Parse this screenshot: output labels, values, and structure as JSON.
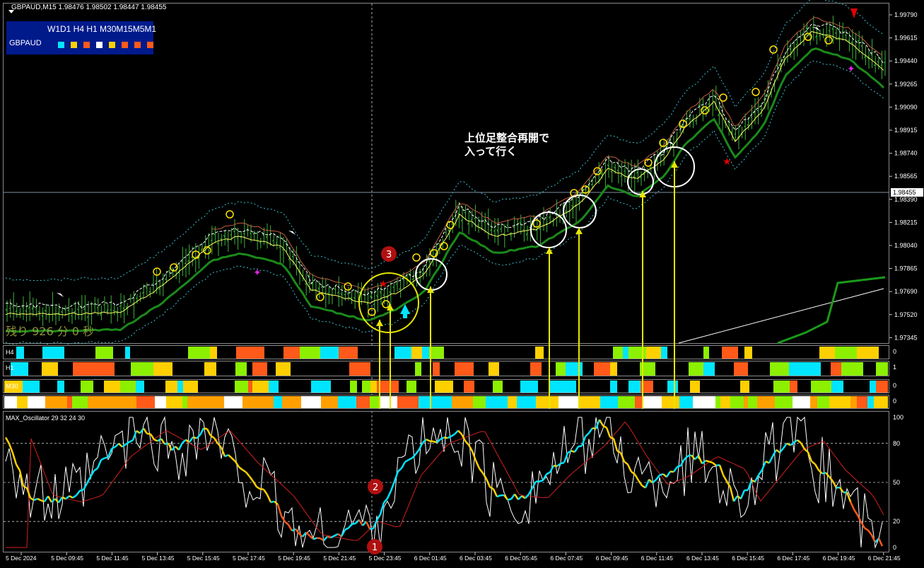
{
  "header": {
    "symbol_tf": "GBPAUD,M15",
    "ohlc": "1.98476 1.98502 1.98447 1.98455"
  },
  "tf_panel": {
    "labels": "W1D1 H4 H1 M30M15M5M1",
    "symbol": "GBPAUD",
    "squares": [
      "#00e5ff",
      "#ffd000",
      "#ff5a1a",
      "#ffffff",
      "#ffd000",
      "#ff5a1a",
      "#ff5a1a",
      "#ff5a1a"
    ]
  },
  "annotation_note": {
    "line1": "上位足整合再開で",
    "line2": "入って行く"
  },
  "remaining_time": "残り 926 分 0 秒",
  "current_price": "1.98455",
  "price_axis": [
    "1.99790",
    "1.99615",
    "1.99440",
    "1.99265",
    "1.99090",
    "1.98915",
    "1.98740",
    "1.98565",
    "1.98390",
    "1.98215",
    "1.98040",
    "1.97865",
    "1.97690",
    "1.97520",
    "1.97345"
  ],
  "subpanels": [
    {
      "label": "H4"
    },
    {
      "label": "H1"
    },
    {
      "label": "M30"
    },
    {
      "label": ""
    }
  ],
  "oscillator": {
    "title": "MAX_Oscillator 29 32 24 30",
    "levels": [
      "100",
      "80",
      "50",
      "20",
      "0"
    ]
  },
  "time_axis": [
    "5 Dec 2024",
    "5 Dec 09:45",
    "5 Dec 11:45",
    "5 Dec 13:45",
    "5 Dec 15:45",
    "5 Dec 17:45",
    "5 Dec 19:45",
    "5 Dec 21:45",
    "5 Dec 23:45",
    "6 Dec 01:45",
    "6 Dec 03:45",
    "6 Dec 05:45",
    "6 Dec 07:45",
    "6 Dec 09:45",
    "6 Dec 11:45",
    "6 Dec 13:45",
    "6 Dec 15:45",
    "6 Dec 17:45",
    "6 Dec 19:45",
    "6 Dec 21:45"
  ],
  "markers": [
    "1",
    "2",
    "3"
  ],
  "colors": {
    "cyan": "#00e5ff",
    "yellow": "#ffd000",
    "orange": "#ff5a1a",
    "lime": "#8cf000",
    "green_candle": "#3cb43c",
    "marker_red": "#b01010"
  }
}
